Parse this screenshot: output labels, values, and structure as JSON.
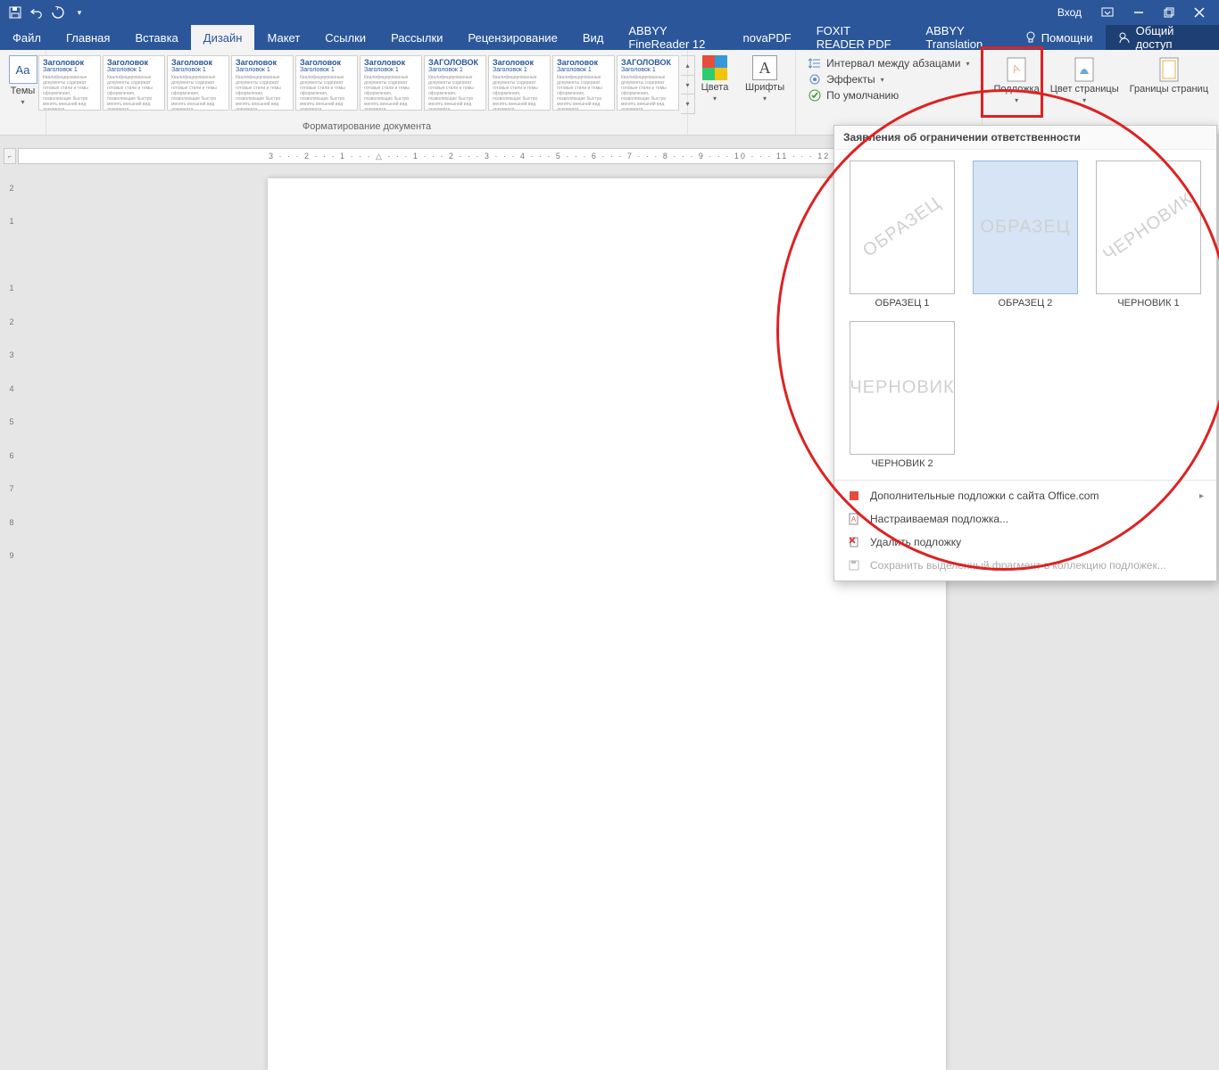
{
  "titlebar": {
    "signin": "Вход"
  },
  "tabs": {
    "items": [
      "Файл",
      "Главная",
      "Вставка",
      "Дизайн",
      "Макет",
      "Ссылки",
      "Рассылки",
      "Рецензирование",
      "Вид",
      "ABBYY FineReader 12",
      "novaPDF",
      "FOXIT READER PDF",
      "ABBYY Translation"
    ],
    "active_index": 3,
    "help": "Помощни",
    "share": "Общий доступ"
  },
  "ribbon": {
    "themes": "Темы",
    "gallery_label": "Форматирование документа",
    "gallery_heading": "Заголовок",
    "gallery_heading_upper": "ЗАГОЛОВОК",
    "gallery_sub": "Заголовок 1",
    "colors": "Цвета",
    "fonts": "Шрифты",
    "spacing": "Интервал между абзацами",
    "effects": "Эффекты",
    "default": "По умолчанию",
    "watermark": "Подложка",
    "page_color": "Цвет страницы",
    "page_borders": "Границы страниц"
  },
  "ruler": {
    "h": "3 · · · 2 · · · 1 · · · △ · · · 1 · · · 2 · · · 3 · · · 4 · · · 5 · · · 6 · · · 7 · · · 8 · · · 9 · · · 10 · · · 11 · · · 12 · · · 13 · · · 14 · · · ",
    "v": [
      "2",
      "1",
      "",
      "1",
      "2",
      "3",
      "4",
      "5",
      "6",
      "7",
      "8",
      "9"
    ]
  },
  "dropdown": {
    "header": "Заявления об ограничении ответственности",
    "items": [
      {
        "text": "ОБРАЗЕЦ",
        "angle": -35,
        "cap": "ОБРАЗЕЦ 1",
        "sel": false
      },
      {
        "text": "ОБРАЗЕЦ",
        "angle": 0,
        "cap": "ОБРАЗЕЦ 2",
        "sel": true
      },
      {
        "text": "ЧЕРНОВИК",
        "angle": -35,
        "cap": "ЧЕРНОВИК 1",
        "sel": false
      },
      {
        "text": "ЧЕРНОВИК",
        "angle": 0,
        "cap": "ЧЕРНОВИК 2",
        "sel": false
      }
    ],
    "opt_more": "Дополнительные подложки с сайта Office.com",
    "opt_custom": "Настраиваемая подложка...",
    "opt_remove": "Удалить подложку",
    "opt_save": "Сохранить выделенный фрагмент в коллекцию подложек..."
  }
}
